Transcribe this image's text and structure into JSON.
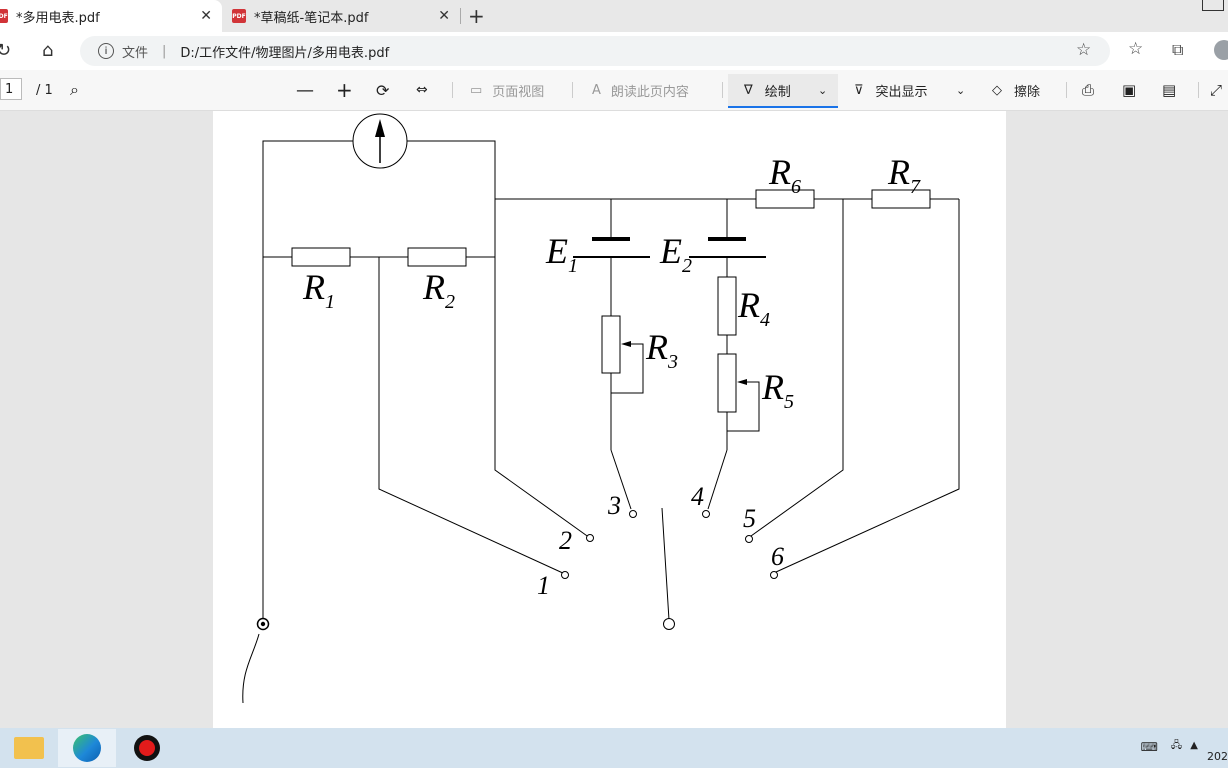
{
  "browser": {
    "tabs": [
      {
        "title": "*多用电表.pdf",
        "active": true
      },
      {
        "title": "*草稿纸-笔记本.pdf",
        "active": false
      }
    ],
    "address": {
      "file_label": "文件",
      "url": "D:/工作文件/物理图片/多用电表.pdf"
    }
  },
  "pdf_toolbar": {
    "page_current": "1",
    "page_total": "/ 1",
    "page_view": "页面视图",
    "read_aloud": "朗读此页内容",
    "draw": "绘制",
    "highlight": "突出显示",
    "erase": "擦除"
  },
  "diagram": {
    "labels": {
      "R1": "R",
      "R1_sub": "1",
      "R2": "R",
      "R2_sub": "2",
      "R3": "R",
      "R3_sub": "3",
      "R4": "R",
      "R4_sub": "4",
      "R5": "R",
      "R5_sub": "5",
      "R6": "R",
      "R6_sub": "6",
      "R7": "R",
      "R7_sub": "7",
      "E1": "E",
      "E1_sub": "1",
      "E2": "E",
      "E2_sub": "2"
    },
    "terminals": [
      "1",
      "2",
      "3",
      "4",
      "5",
      "6"
    ]
  },
  "taskbar": {
    "clock_year": "202"
  }
}
